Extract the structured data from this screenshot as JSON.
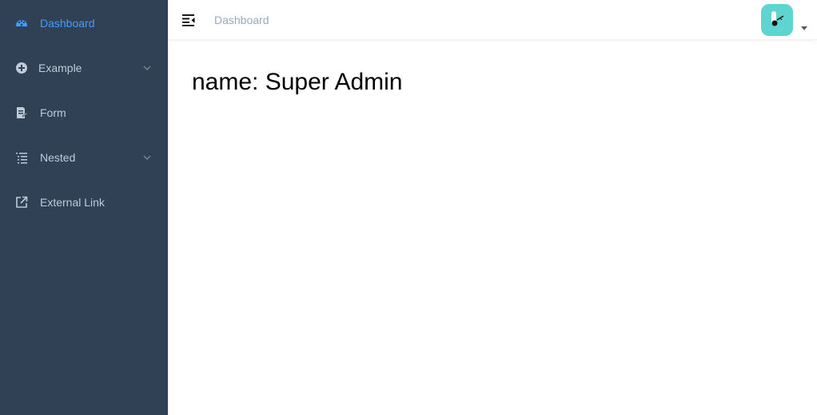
{
  "sidebar": {
    "items": [
      {
        "label": "Dashboard",
        "icon": "dashboard-icon",
        "active": true
      },
      {
        "label": "Example",
        "icon": "example-icon",
        "has_children": true
      },
      {
        "label": "Form",
        "icon": "form-icon"
      },
      {
        "label": "Nested",
        "icon": "nested-icon",
        "has_children": true
      },
      {
        "label": "External Link",
        "icon": "external-link-icon"
      }
    ]
  },
  "navbar": {
    "breadcrumb": "Dashboard",
    "hamburger_icon": "hamburger-icon",
    "avatar_icon": "avatar"
  },
  "main": {
    "greeting": "name: Super Admin"
  },
  "colors": {
    "sidebar_bg": "#304156",
    "sidebar_text": "#bfcbd9",
    "active": "#409eff",
    "breadcrumb": "#97a8be",
    "avatar_bg": "#5ed5d1"
  }
}
